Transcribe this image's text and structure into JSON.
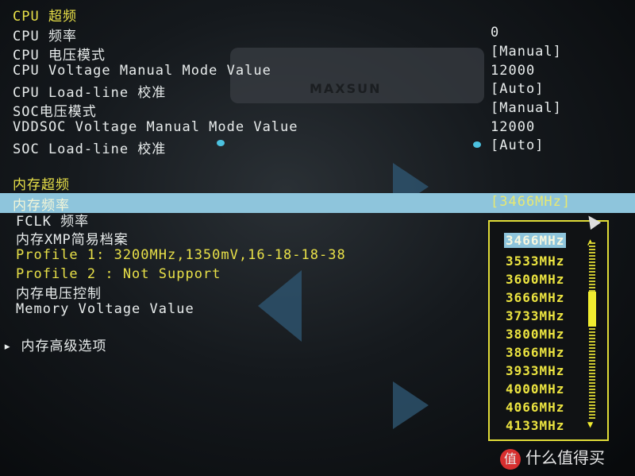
{
  "cpu_section": {
    "title": "CPU 超频",
    "items": [
      {
        "label": "CPU 频率",
        "value": "0"
      },
      {
        "label": "CPU 电压模式",
        "value": "[Manual]"
      },
      {
        "label": "CPU Voltage Manual Mode Value",
        "value": "12000"
      },
      {
        "label": "CPU Load-line 校准",
        "value": "[Auto]"
      },
      {
        "label": "SOC电压模式",
        "value": "[Manual]"
      },
      {
        "label": "VDDSOC Voltage Manual Mode Value",
        "value": "12000"
      },
      {
        "label": "SOC Load-line 校准",
        "value": "[Auto]"
      }
    ]
  },
  "memory_section": {
    "title": "内存超频",
    "selected": {
      "label": "内存频率",
      "value": "[3466MHz]"
    },
    "items": [
      {
        "label": "FCLK 频率"
      },
      {
        "label": "内存XMP简易档案"
      },
      {
        "label": "Profile 1: 3200MHz,1350mV,16-18-18-38"
      },
      {
        "label": "Profile 2 : Not Support"
      },
      {
        "label": "内存电压控制"
      },
      {
        "label": "Memory Voltage Value"
      }
    ],
    "submenu": "内存高级选项"
  },
  "dropdown": {
    "options": [
      "3466MHz",
      "3533MHz",
      "3600MHz",
      "3666MHz",
      "3733MHz",
      "3800MHz",
      "3866MHz",
      "3933MHz",
      "4000MHz",
      "4066MHz",
      "4133MHz"
    ],
    "selected_index": 0,
    "scroll_position_fraction": 0.35
  },
  "background_logo": "MAXSUN",
  "watermark": {
    "icon": "值",
    "text": "什么值得买"
  },
  "colors": {
    "highlight": "#8ec5dc",
    "accent_yellow": "#e8e048",
    "text": "#e8ecec"
  }
}
